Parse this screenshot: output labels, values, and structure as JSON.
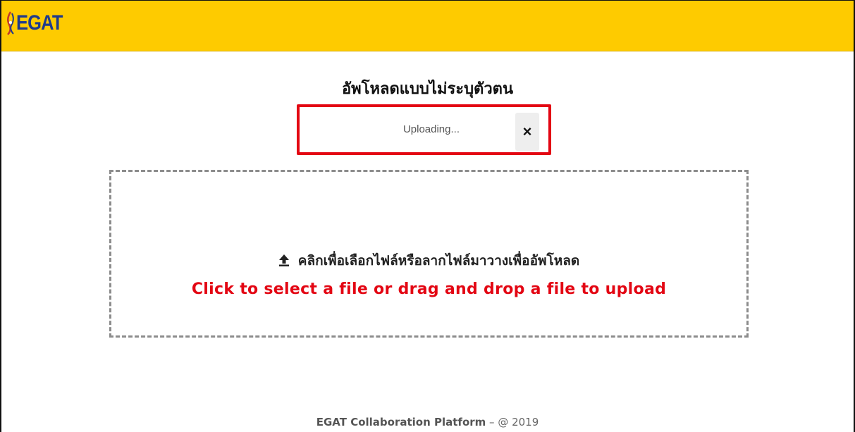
{
  "header": {
    "logo_text": "EGAT",
    "brand_color": "#fecb00",
    "logo_icon": "egat-logo-icon"
  },
  "page": {
    "title": "อัพโหลดแบบไม่ระบุตัวตน"
  },
  "upload_status": {
    "text": "Uploading...",
    "cancel_label": "×",
    "highlight_color": "#e30613"
  },
  "dropzone": {
    "icon": "upload-icon",
    "instruction_thai": "คลิกเพื่อเลือกไฟล์หรือลากไฟล์มาวางเพื่ออัพโหลด",
    "instruction_english": "Click to select a file or drag and drop a file to upload"
  },
  "footer": {
    "platform_name": "EGAT Collaboration Platform",
    "suffix": " – @ 2019"
  }
}
